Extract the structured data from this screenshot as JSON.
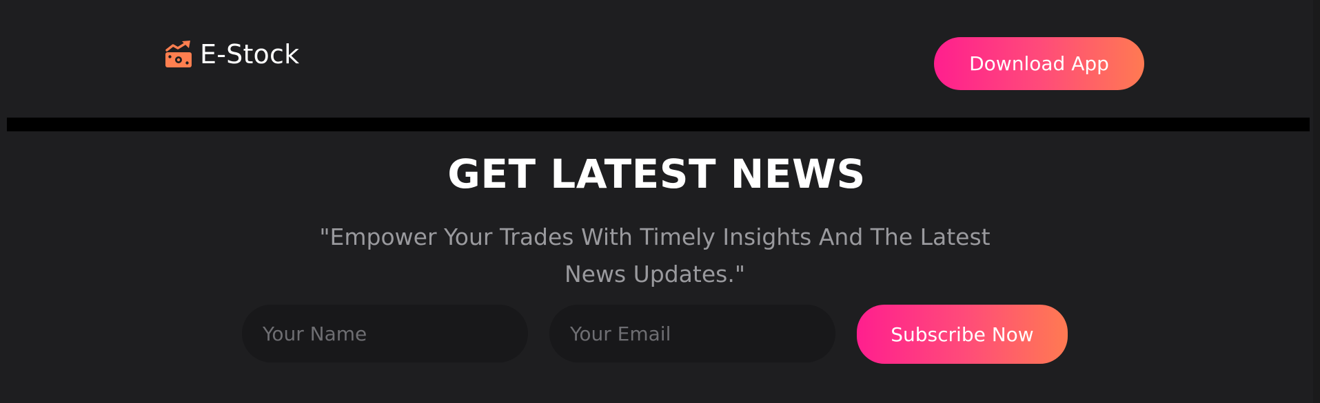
{
  "header": {
    "brand_name": "E-Stock",
    "brand_icon": "money-bill-trend-up-icon",
    "download_label": "Download App"
  },
  "newsletter": {
    "title": "GET LATEST NEWS",
    "subtitle": "\"Empower Your Trades With Timely Insights And The Latest News Updates.\"",
    "name_placeholder": "Your Name",
    "email_placeholder": "Your Email",
    "subscribe_label": "Subscribe Now"
  },
  "colors": {
    "background": "#1e1e20",
    "accent_start": "#ff1f8e",
    "accent_end": "#ff7a52",
    "icon": "#ff7f50",
    "divider": "#000000",
    "input_bg": "#18181a",
    "subtitle_text": "#9a9a9e"
  }
}
